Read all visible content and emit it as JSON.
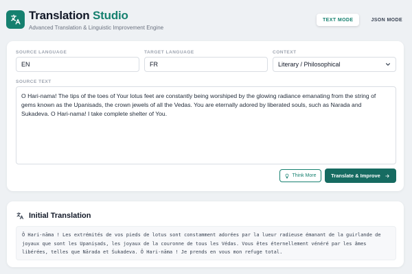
{
  "header": {
    "title_main": "Translation",
    "title_accent": "Studio",
    "subtitle": "Advanced Translation & Linguistic Improvement Engine",
    "modes": [
      {
        "label": "TEXT MODE",
        "active": true
      },
      {
        "label": "JSON MODE",
        "active": false
      }
    ]
  },
  "form": {
    "source_language": {
      "label": "SOURCE LANGUAGE",
      "value": "EN"
    },
    "target_language": {
      "label": "TARGET LANGUAGE",
      "value": "FR"
    },
    "context": {
      "label": "CONTEXT",
      "value": "Literary / Philosophical"
    },
    "source_text": {
      "label": "SOURCE TEXT",
      "value": "O Hari-nama! The tips of the toes of Your lotus feet are constantly being worshiped by the glowing radiance emanating from the string of gems known as the Upanisads, the crown jewels of all the Vedas. You are eternally adored by liberated souls, such as Narada and Sukadeva. O Hari-nama! I take complete shelter of You."
    },
    "think_button": "Think More",
    "translate_button": "Translate & Improve"
  },
  "output": {
    "title": "Initial Translation",
    "text": "Ô Hari-nāma ! Les extrémités de vos pieds de lotus sont constamment adorées par la lueur radieuse émanant de la guirlande de joyaux que sont les Upaniṣads, les joyaux de la couronne de tous les Védas. Vous êtes éternellement vénéré par les âmes libérées, telles que Nārada et Śukadeva. Ô Hari-nāma ! Je prends en vous mon refuge total."
  },
  "colors": {
    "accent": "#15806f",
    "button_dark": "#166b61",
    "background": "#eef1f4"
  },
  "icons": {
    "logo": "translate-icon",
    "think": "lightbulb-icon",
    "translate": "arrow-right-icon",
    "output": "translate-icon",
    "context_select": "chevron-down-icon"
  }
}
